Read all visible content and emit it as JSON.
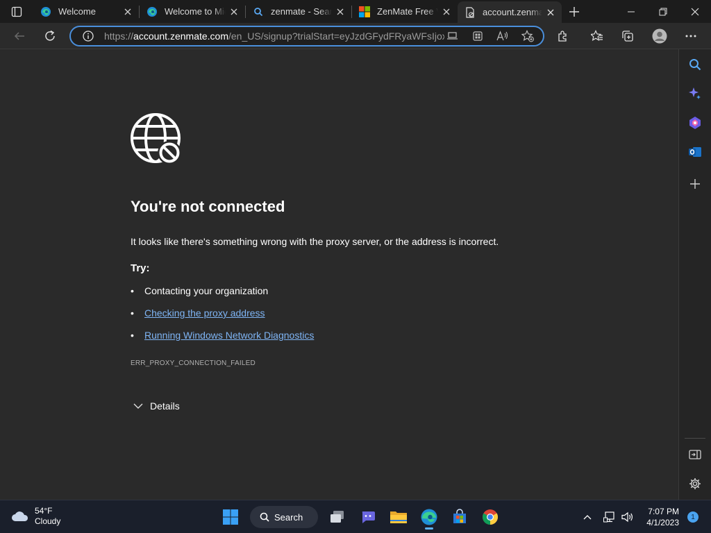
{
  "tabs": [
    {
      "title": "Welcome",
      "icon": "edge-icon"
    },
    {
      "title": "Welcome to Microsoft Edge",
      "icon": "edge-icon"
    },
    {
      "title": "zenmate - Search",
      "icon": "search-icon"
    },
    {
      "title": "ZenMate Free VPN",
      "icon": "microsoft-icon"
    },
    {
      "title": "account.zenmate.com",
      "icon": "page-error-icon",
      "active": true
    }
  ],
  "address_bar": {
    "scheme": "https://",
    "host": "account.zenmate.com",
    "path": "/en_US/signup?trialStart=eyJzdGFydFRyaWFsIjoxL"
  },
  "error_page": {
    "title": "You're not connected",
    "description": "It looks like there's something wrong with the proxy server, or the address is incorrect.",
    "try_label": "Try:",
    "suggestions": [
      {
        "text": "Contacting your organization",
        "link": false
      },
      {
        "text": "Checking the proxy address",
        "link": true
      },
      {
        "text": "Running Windows Network Diagnostics",
        "link": true
      }
    ],
    "error_code": "ERR_PROXY_CONNECTION_FAILED",
    "details_label": "Details"
  },
  "taskbar": {
    "weather_temp": "54°F",
    "weather_cond": "Cloudy",
    "search_label": "Search",
    "time": "7:07 PM",
    "date": "4/1/2023",
    "notification_count": "1"
  },
  "colors": {
    "accent": "#4a8fdc",
    "link": "#7fb5f5",
    "background": "#2a2a2a"
  }
}
